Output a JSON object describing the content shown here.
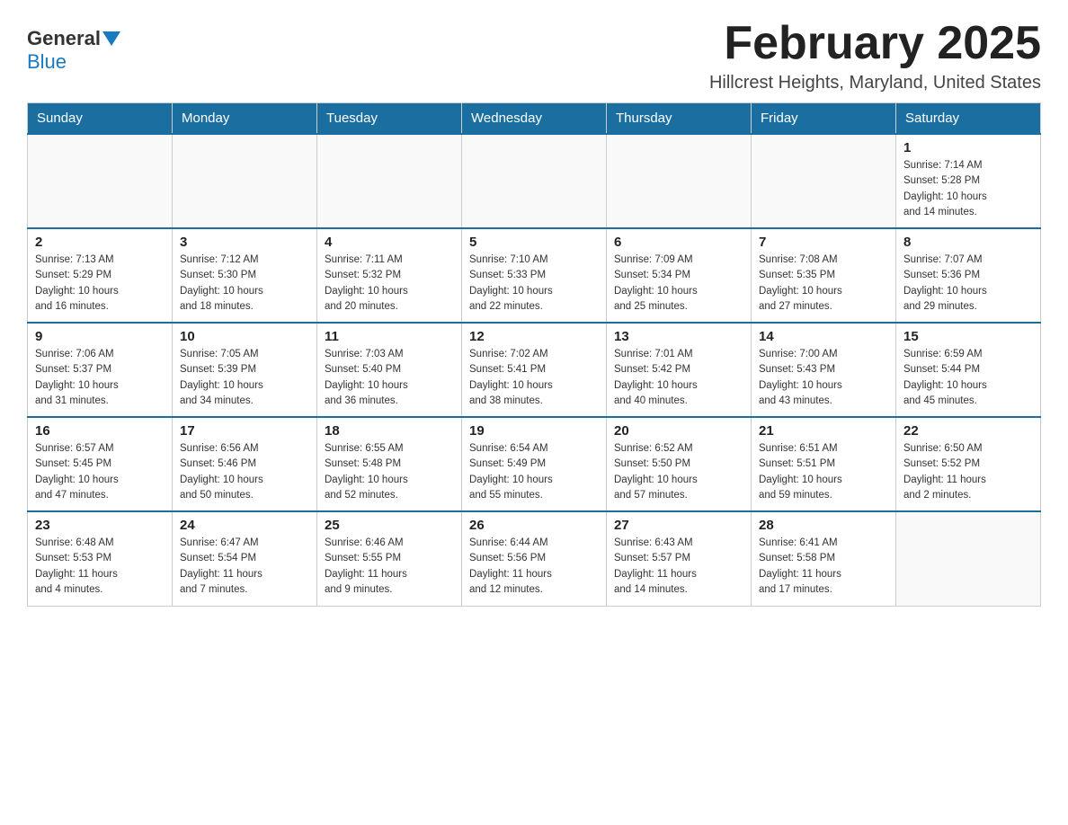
{
  "logo": {
    "general": "General",
    "blue": "Blue"
  },
  "title": "February 2025",
  "location": "Hillcrest Heights, Maryland, United States",
  "days_of_week": [
    "Sunday",
    "Monday",
    "Tuesday",
    "Wednesday",
    "Thursday",
    "Friday",
    "Saturday"
  ],
  "weeks": [
    [
      {
        "day": "",
        "info": ""
      },
      {
        "day": "",
        "info": ""
      },
      {
        "day": "",
        "info": ""
      },
      {
        "day": "",
        "info": ""
      },
      {
        "day": "",
        "info": ""
      },
      {
        "day": "",
        "info": ""
      },
      {
        "day": "1",
        "info": "Sunrise: 7:14 AM\nSunset: 5:28 PM\nDaylight: 10 hours\nand 14 minutes."
      }
    ],
    [
      {
        "day": "2",
        "info": "Sunrise: 7:13 AM\nSunset: 5:29 PM\nDaylight: 10 hours\nand 16 minutes."
      },
      {
        "day": "3",
        "info": "Sunrise: 7:12 AM\nSunset: 5:30 PM\nDaylight: 10 hours\nand 18 minutes."
      },
      {
        "day": "4",
        "info": "Sunrise: 7:11 AM\nSunset: 5:32 PM\nDaylight: 10 hours\nand 20 minutes."
      },
      {
        "day": "5",
        "info": "Sunrise: 7:10 AM\nSunset: 5:33 PM\nDaylight: 10 hours\nand 22 minutes."
      },
      {
        "day": "6",
        "info": "Sunrise: 7:09 AM\nSunset: 5:34 PM\nDaylight: 10 hours\nand 25 minutes."
      },
      {
        "day": "7",
        "info": "Sunrise: 7:08 AM\nSunset: 5:35 PM\nDaylight: 10 hours\nand 27 minutes."
      },
      {
        "day": "8",
        "info": "Sunrise: 7:07 AM\nSunset: 5:36 PM\nDaylight: 10 hours\nand 29 minutes."
      }
    ],
    [
      {
        "day": "9",
        "info": "Sunrise: 7:06 AM\nSunset: 5:37 PM\nDaylight: 10 hours\nand 31 minutes."
      },
      {
        "day": "10",
        "info": "Sunrise: 7:05 AM\nSunset: 5:39 PM\nDaylight: 10 hours\nand 34 minutes."
      },
      {
        "day": "11",
        "info": "Sunrise: 7:03 AM\nSunset: 5:40 PM\nDaylight: 10 hours\nand 36 minutes."
      },
      {
        "day": "12",
        "info": "Sunrise: 7:02 AM\nSunset: 5:41 PM\nDaylight: 10 hours\nand 38 minutes."
      },
      {
        "day": "13",
        "info": "Sunrise: 7:01 AM\nSunset: 5:42 PM\nDaylight: 10 hours\nand 40 minutes."
      },
      {
        "day": "14",
        "info": "Sunrise: 7:00 AM\nSunset: 5:43 PM\nDaylight: 10 hours\nand 43 minutes."
      },
      {
        "day": "15",
        "info": "Sunrise: 6:59 AM\nSunset: 5:44 PM\nDaylight: 10 hours\nand 45 minutes."
      }
    ],
    [
      {
        "day": "16",
        "info": "Sunrise: 6:57 AM\nSunset: 5:45 PM\nDaylight: 10 hours\nand 47 minutes."
      },
      {
        "day": "17",
        "info": "Sunrise: 6:56 AM\nSunset: 5:46 PM\nDaylight: 10 hours\nand 50 minutes."
      },
      {
        "day": "18",
        "info": "Sunrise: 6:55 AM\nSunset: 5:48 PM\nDaylight: 10 hours\nand 52 minutes."
      },
      {
        "day": "19",
        "info": "Sunrise: 6:54 AM\nSunset: 5:49 PM\nDaylight: 10 hours\nand 55 minutes."
      },
      {
        "day": "20",
        "info": "Sunrise: 6:52 AM\nSunset: 5:50 PM\nDaylight: 10 hours\nand 57 minutes."
      },
      {
        "day": "21",
        "info": "Sunrise: 6:51 AM\nSunset: 5:51 PM\nDaylight: 10 hours\nand 59 minutes."
      },
      {
        "day": "22",
        "info": "Sunrise: 6:50 AM\nSunset: 5:52 PM\nDaylight: 11 hours\nand 2 minutes."
      }
    ],
    [
      {
        "day": "23",
        "info": "Sunrise: 6:48 AM\nSunset: 5:53 PM\nDaylight: 11 hours\nand 4 minutes."
      },
      {
        "day": "24",
        "info": "Sunrise: 6:47 AM\nSunset: 5:54 PM\nDaylight: 11 hours\nand 7 minutes."
      },
      {
        "day": "25",
        "info": "Sunrise: 6:46 AM\nSunset: 5:55 PM\nDaylight: 11 hours\nand 9 minutes."
      },
      {
        "day": "26",
        "info": "Sunrise: 6:44 AM\nSunset: 5:56 PM\nDaylight: 11 hours\nand 12 minutes."
      },
      {
        "day": "27",
        "info": "Sunrise: 6:43 AM\nSunset: 5:57 PM\nDaylight: 11 hours\nand 14 minutes."
      },
      {
        "day": "28",
        "info": "Sunrise: 6:41 AM\nSunset: 5:58 PM\nDaylight: 11 hours\nand 17 minutes."
      },
      {
        "day": "",
        "info": ""
      }
    ]
  ]
}
